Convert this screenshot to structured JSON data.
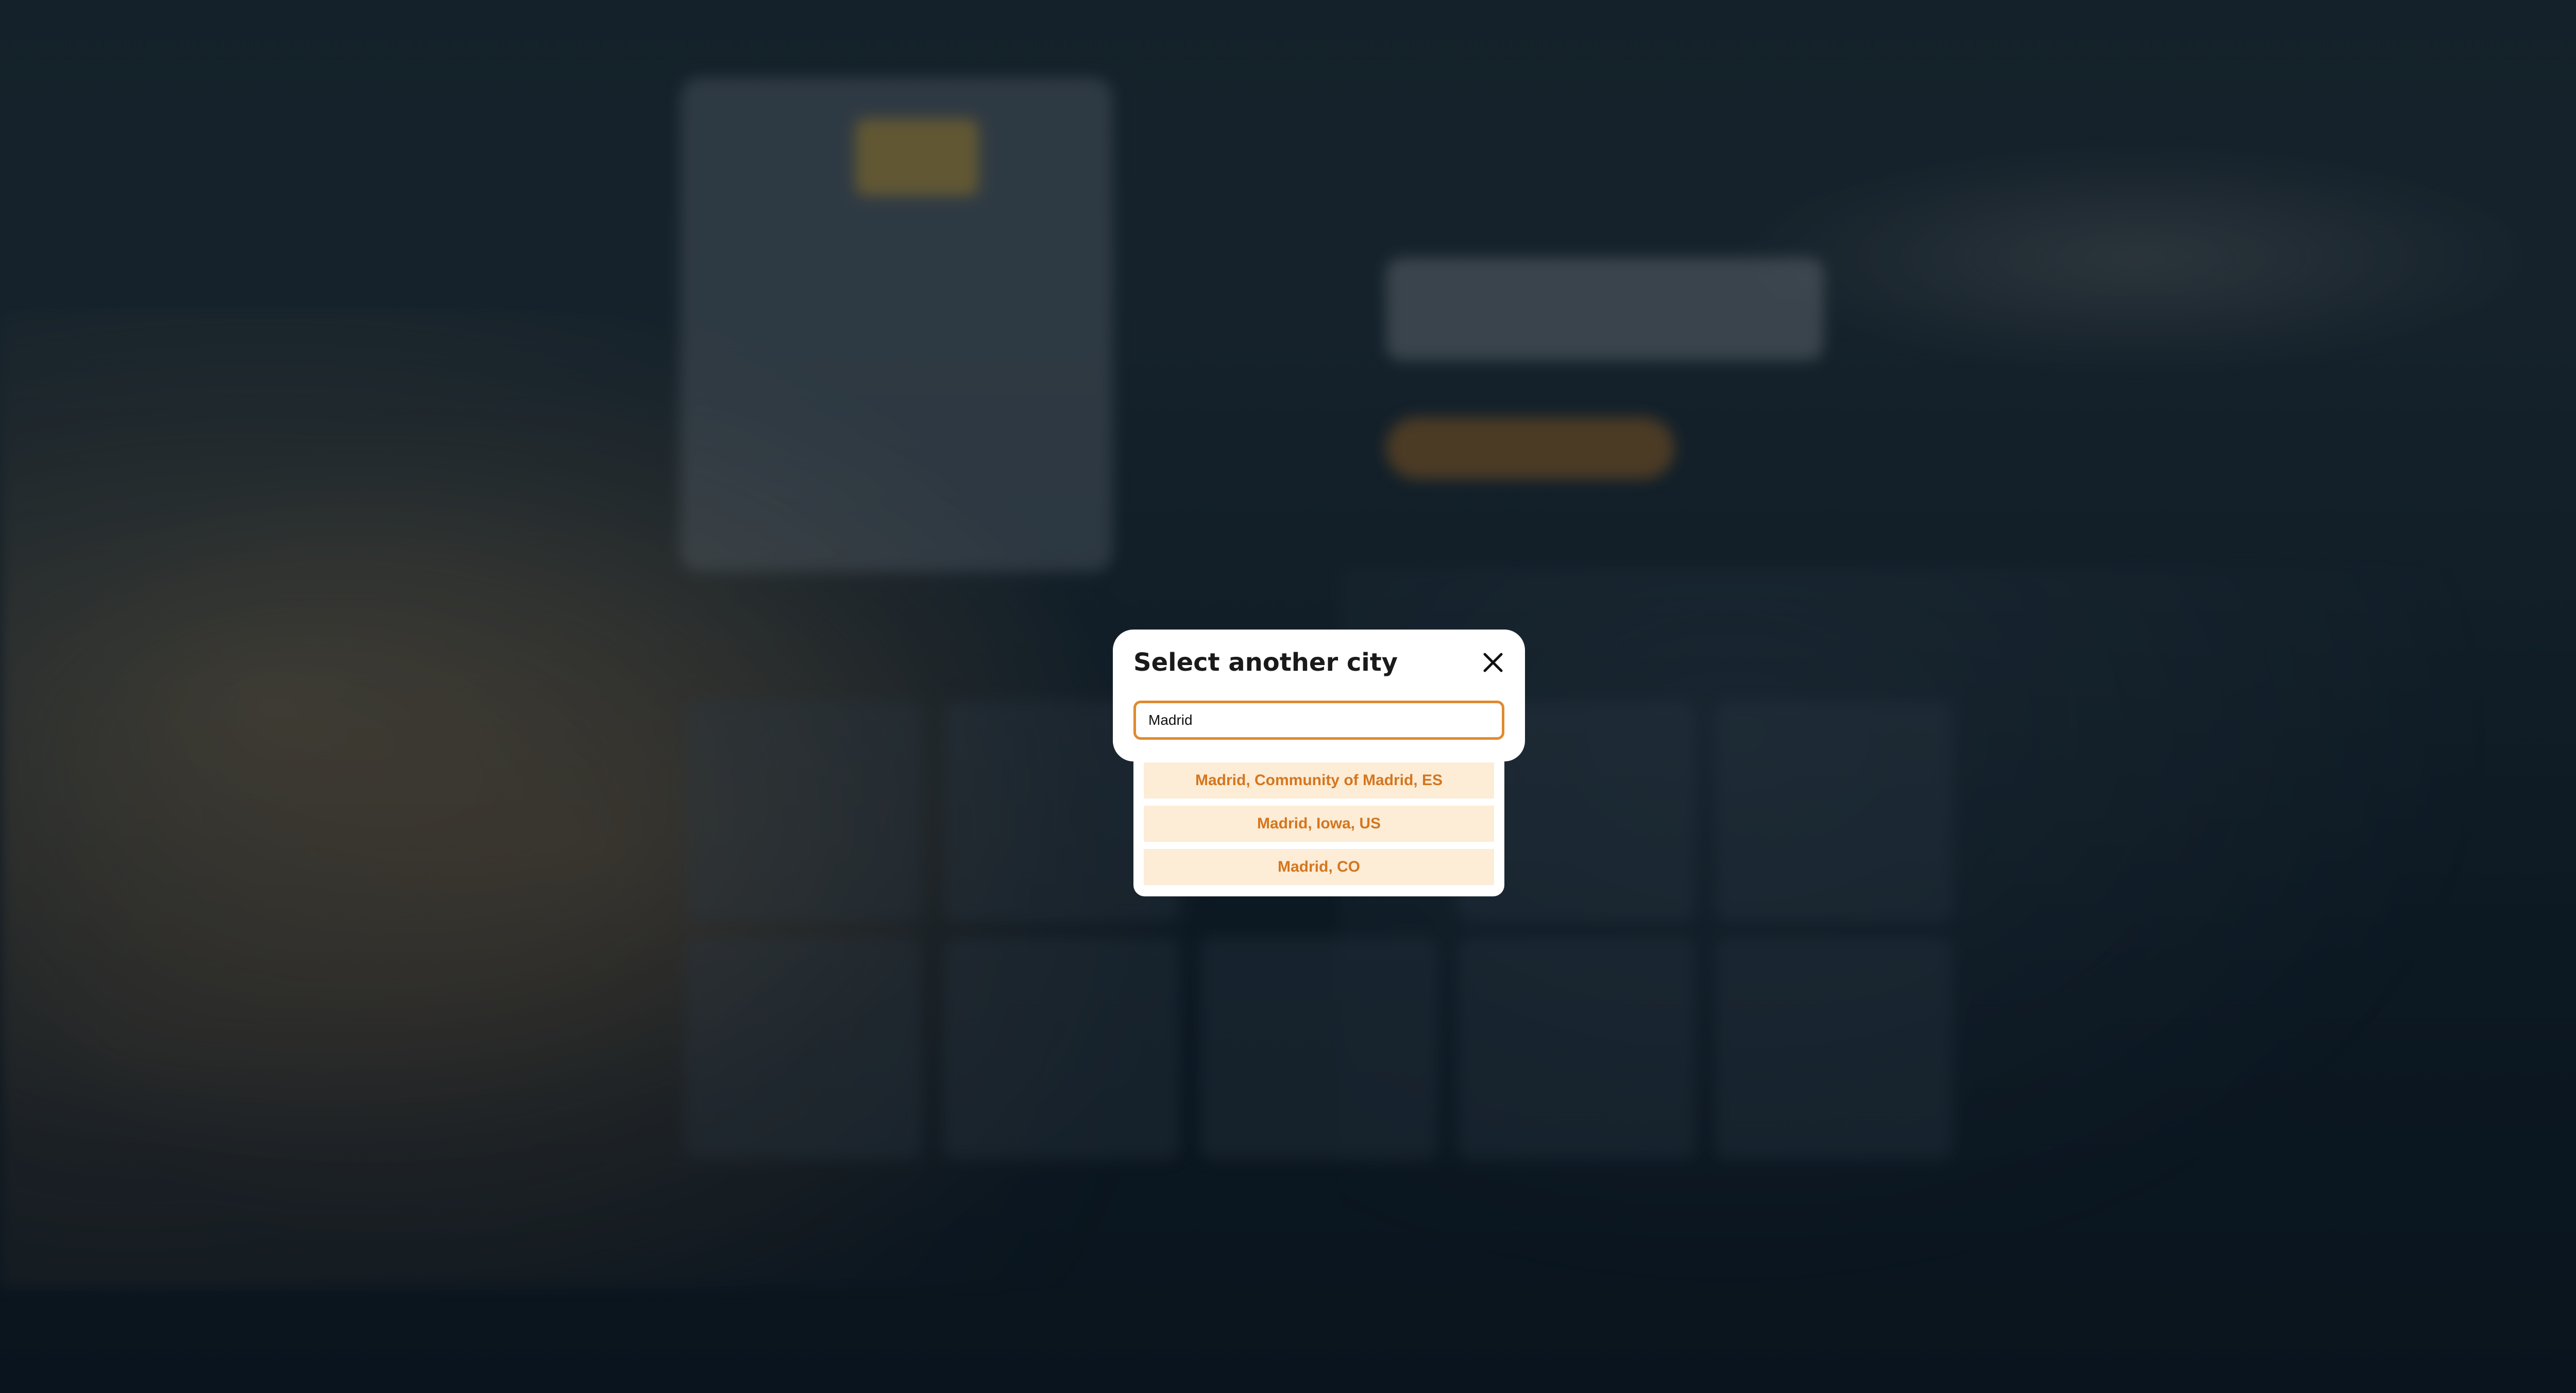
{
  "modal": {
    "title": "Select another city",
    "close_icon": "close-icon",
    "search": {
      "value": "Madrid",
      "placeholder": ""
    },
    "suggestions": [
      {
        "label": "Madrid, Community of Madrid, ES"
      },
      {
        "label": "Madrid, Iowa, US"
      },
      {
        "label": "Madrid, CO"
      }
    ]
  },
  "colors": {
    "accent": "#e08a2e",
    "suggestion_bg": "#fdecd6",
    "suggestion_text": "#d4761d"
  }
}
